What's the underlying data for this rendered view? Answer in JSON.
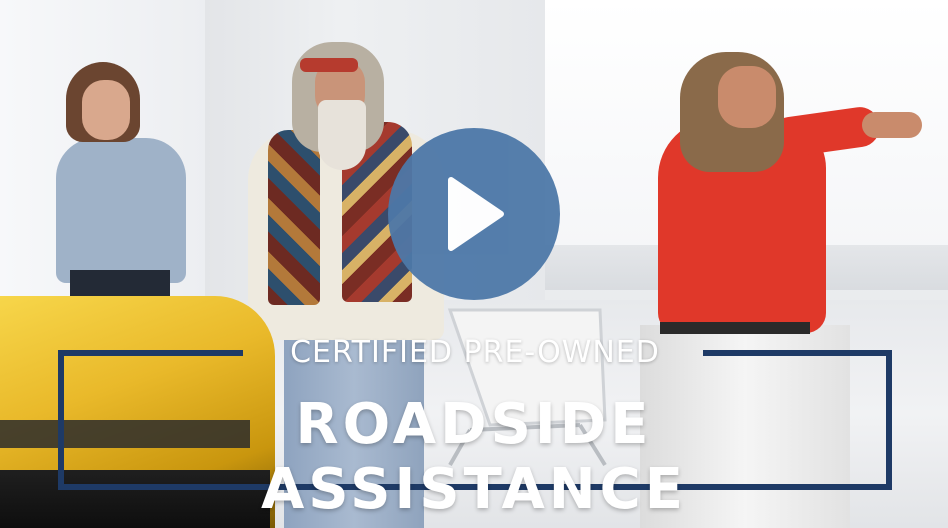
{
  "video": {
    "subtitle": "CERTIFIED PRE-OWNED",
    "title": "ROADSIDE ASSISTANCE",
    "play_icon": "play-icon",
    "colors": {
      "play_button": "#4d78a8",
      "frame": "#1e3a66",
      "text": "#ffffff"
    }
  }
}
